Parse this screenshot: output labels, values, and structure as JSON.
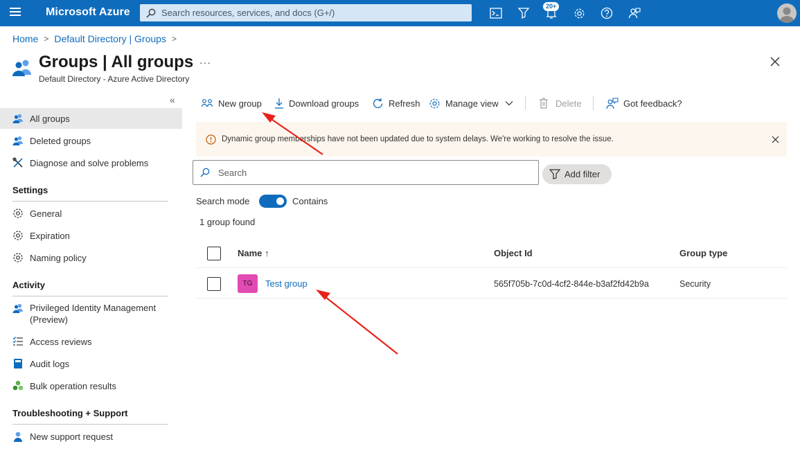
{
  "topbar": {
    "brand": "Microsoft Azure",
    "search_placeholder": "Search resources, services, and docs (G+/)",
    "notifications_badge": "20+"
  },
  "breadcrumb": {
    "home": "Home",
    "directory": "Default Directory | Groups"
  },
  "header": {
    "title": "Groups | All groups",
    "subtitle": "Default Directory - Azure Active Directory",
    "more": "···"
  },
  "sidebar": {
    "collapse": "«",
    "top_items": [
      {
        "label": "All groups",
        "icon": "groups-icon"
      },
      {
        "label": "Deleted groups",
        "icon": "groups-icon"
      },
      {
        "label": "Diagnose and solve problems",
        "icon": "wrench-icon"
      }
    ],
    "settings_heading": "Settings",
    "settings_items": [
      {
        "label": "General",
        "icon": "gear-icon"
      },
      {
        "label": "Expiration",
        "icon": "gear-icon"
      },
      {
        "label": "Naming policy",
        "icon": "gear-icon"
      }
    ],
    "activity_heading": "Activity",
    "activity_items": [
      {
        "label": "Privileged Identity Management (Preview)",
        "icon": "groups-icon"
      },
      {
        "label": "Access reviews",
        "icon": "checklist-icon"
      },
      {
        "label": "Audit logs",
        "icon": "book-icon"
      },
      {
        "label": "Bulk operation results",
        "icon": "bulk-icon"
      }
    ],
    "support_heading": "Troubleshooting + Support",
    "support_items": [
      {
        "label": "New support request",
        "icon": "support-person-icon"
      }
    ]
  },
  "commands": {
    "new_group": "New group",
    "download_groups": "Download groups",
    "refresh": "Refresh",
    "manage_view": "Manage view",
    "delete": "Delete",
    "feedback": "Got feedback?"
  },
  "banner": {
    "message": "Dynamic group memberships have not been updated due to system delays. We're working to resolve the issue."
  },
  "filters": {
    "search_placeholder": "Search",
    "add_filter": "Add filter",
    "search_mode_label": "Search mode",
    "search_mode_value": "Contains",
    "result_count": "1 group found"
  },
  "table": {
    "headers": {
      "name": "Name ↑",
      "object_id": "Object Id",
      "group_type": "Group type"
    },
    "rows": [
      {
        "initials": "TG",
        "name": "Test group",
        "object_id": "565f705b-7c0d-4cf2-844e-b3af2fd42b9a",
        "group_type": "Security"
      }
    ]
  },
  "colors": {
    "azure_blue": "#0f6cbd",
    "banner_bg": "#fdf6ee",
    "avatar_pink": "#e24bb3",
    "annotation_red": "#e8221b"
  }
}
